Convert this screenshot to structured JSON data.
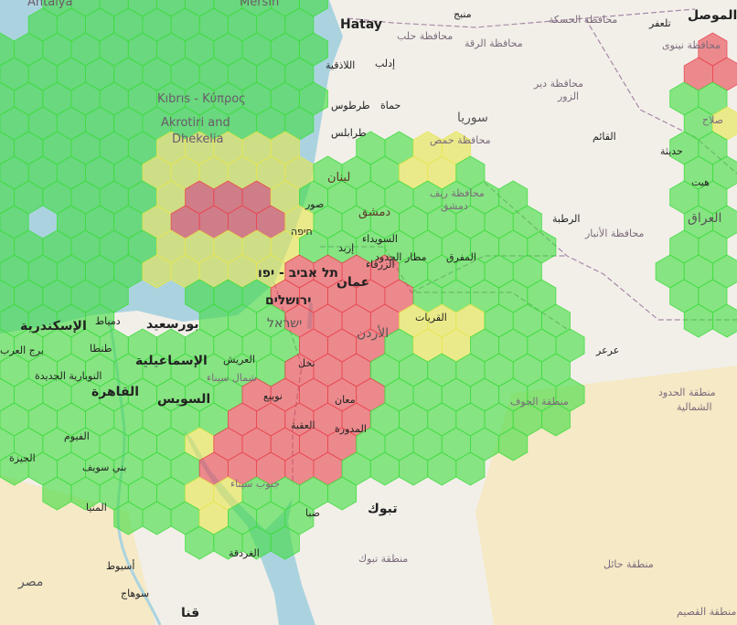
{
  "map": {
    "colors": {
      "sea": "#aad3df",
      "land": "#f2efe9",
      "desert": "#f5e9c6",
      "good": "#3ddc3d",
      "moderate": "#e6e64c",
      "bad": "#e8454f"
    },
    "labels": {
      "hatay": "Hatay",
      "antalya": "Antalya",
      "mersin": "Mersin",
      "kibris": "Kıbrıs - Κύπρος",
      "akrotiri": "Akrotiri and",
      "dhekelia": "Dhekelia",
      "syria": "سوريا",
      "iraq": "العراق",
      "jordan": "الأردن",
      "egypt": "مصر",
      "israel": "ישראל",
      "tel_aviv": "תל אביב - יפו",
      "jerusalem": "ירושלים",
      "amman": "عمان",
      "damascus": "دمشق",
      "beirut": "لبنان",
      "cairo": "القاهرة",
      "alexandria": "الإسكندرية",
      "ismailia": "الإسماعيلية",
      "suez": "السويس",
      "port_said": "بورسعيد",
      "tanta": "طنطا",
      "tabuk": "تبوك",
      "aqaba": "العقبة",
      "maan": "معان",
      "zarqa": "الزرقاء",
      "mafraq": "المفرق",
      "arar": "عرعر",
      "rutba": "الرطبة",
      "qaim": "القائم",
      "haditha": "حديثة",
      "hit": "هيت",
      "latakia": "اللاذقية",
      "tartus": "طرطوس",
      "tripoli": "طرابلس",
      "homs_gov": "محافظة حمص",
      "hama": "حماة",
      "idlib": "إدلب",
      "raqqa_gov": "محافظة الرقة",
      "hasakah_gov": "محافظة الحسكة",
      "deir": "محافظة دير",
      "zor": "الزور",
      "nineveh_gov": "محافظة نينوى",
      "mosul": "الموصل",
      "tal_afar": "تلعفر",
      "manbij": "منبج",
      "aleppo_gov": "محافظة حلب",
      "salah": "صلاح",
      "anbar_gov": "محافظة الأنبار",
      "northern_border_1": "منطقة الحدود",
      "northern_border_2": "الشمالية",
      "jawf_gov": "منطقة الجوف",
      "tabuk_gov": "منطقة تبوك",
      "hail_gov": "منطقة حائل",
      "qassim_gov": "منطقة القصيم",
      "rif_dimashq": "محافظة ريف",
      "rif_dimashq2": "دمشق",
      "suwayda": "السويداء",
      "irbid": "إربد",
      "haifa": "חיפה",
      "tyre": "صور",
      "north_sinai": "شمال سيناء",
      "south_sinai": "جنوب سيناء",
      "arish": "العريش",
      "nakhl": "نخل",
      "mudawwara": "المدورة",
      "qurayyat": "القريات",
      "northern_dist": "مطار الحدود",
      "giza": "الجيزة",
      "faiyum": "الفيوم",
      "beni_suef": "بني سويف",
      "minya": "المنيا",
      "asyut": "أسيوط",
      "sohag": "سوهاج",
      "qena": "قنا",
      "hurghada": "الغردقة",
      "duba": "ضبا",
      "nuweiba": "نويبع",
      "beheira": "النوبارية الجديدة",
      "arab_tower": "برج العرب",
      "dam": "دمياط"
    }
  }
}
